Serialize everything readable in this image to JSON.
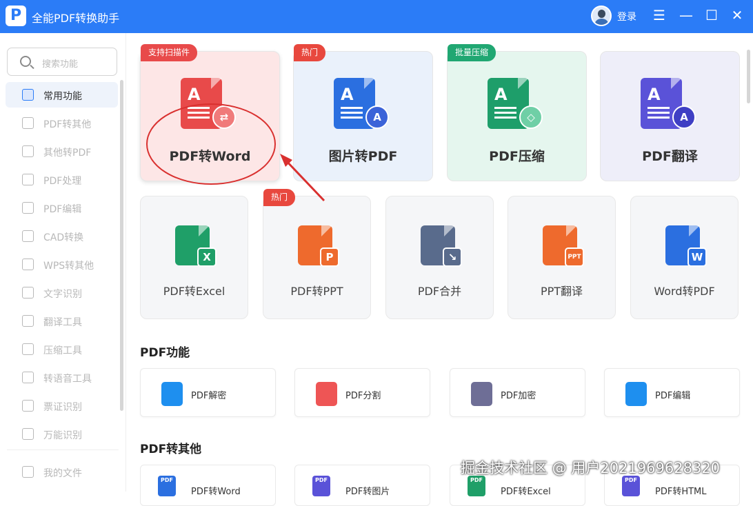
{
  "titlebar": {
    "title": "全能PDF转换助手",
    "logo": "P",
    "login": "登录",
    "menu_icon": "☰",
    "minimize_icon": "—",
    "maximize_icon": "☐",
    "close_icon": "✕"
  },
  "sidebar": {
    "search_placeholder": "搜索功能",
    "items": [
      {
        "label": "常用功能",
        "icon": "grid-icon"
      },
      {
        "label": "PDF转其他",
        "icon": "pdf-export-icon"
      },
      {
        "label": "其他转PDF",
        "icon": "pdf-import-icon"
      },
      {
        "label": "PDF处理",
        "icon": "pdf-process-icon"
      },
      {
        "label": "PDF编辑",
        "icon": "pdf-edit-icon"
      },
      {
        "label": "CAD转换",
        "icon": "cad-icon"
      },
      {
        "label": "WPS转其他",
        "icon": "wps-icon"
      },
      {
        "label": "文字识别",
        "icon": "ocr-icon"
      },
      {
        "label": "翻译工具",
        "icon": "translate-icon"
      },
      {
        "label": "压缩工具",
        "icon": "compress-icon"
      },
      {
        "label": "转语音工具",
        "icon": "speech-icon"
      },
      {
        "label": "票证识别",
        "icon": "ticket-icon"
      },
      {
        "label": "万能识别",
        "icon": "scan-icon"
      }
    ],
    "my_files": "我的文件"
  },
  "featured": [
    {
      "label": "PDF转Word",
      "tag": "支持扫描件",
      "bg": "#fde6e6",
      "tag_color": "#e84a4a",
      "icon_color": "#e84a4a",
      "badge": "⇄",
      "badge_color": "#f07a7a"
    },
    {
      "label": "图片转PDF",
      "tag": "热门",
      "bg": "#eaf1fb",
      "tag_color": "#e8483e",
      "icon_color": "#2b6fe0",
      "badge": "A",
      "badge_color": "#3b63d8"
    },
    {
      "label": "PDF压缩",
      "tag": "批量压缩",
      "bg": "#e5f6ee",
      "tag_color": "#20a772",
      "icon_color": "#1e9e6a",
      "badge": "◇",
      "badge_color": "#6fcfa6"
    },
    {
      "label": "PDF翻译",
      "tag": "",
      "bg": "#eeeef9",
      "tag_color": "#ffffff",
      "icon_color": "#5a52d8",
      "badge": "A",
      "badge_color": "#3f3fc4"
    }
  ],
  "tools": [
    {
      "label": "PDF转Excel",
      "tag": "",
      "icon_color": "#1f9f68",
      "glyph": "X"
    },
    {
      "label": "PDF转PPT",
      "tag": "热门",
      "icon_color": "#ee6a2d",
      "glyph": "P"
    },
    {
      "label": "PDF合并",
      "tag": "",
      "icon_color": "#596b8c",
      "glyph": "↘"
    },
    {
      "label": "PPT翻译",
      "tag": "",
      "icon_color": "#ee6a2d",
      "glyph": "PPT"
    },
    {
      "label": "Word转PDF",
      "tag": "",
      "icon_color": "#2b6fe0",
      "glyph": "W"
    }
  ],
  "pdf_functions": {
    "title": "PDF功能",
    "items": [
      {
        "label": "PDF解密",
        "icon_color": "#1e8fef"
      },
      {
        "label": "PDF分割",
        "icon_color": "#ee5555"
      },
      {
        "label": "PDF加密",
        "icon_color": "#6e6e96"
      },
      {
        "label": "PDF编辑",
        "icon_color": "#1e8fef"
      }
    ]
  },
  "pdf_to_other": {
    "title": "PDF转其他",
    "items": [
      {
        "label": "PDF转Word",
        "icon_color": "#2b6fe0"
      },
      {
        "label": "PDF转图片",
        "icon_color": "#5a52d8"
      },
      {
        "label": "PDF转Excel",
        "icon_color": "#1f9f68"
      },
      {
        "label": "PDF转HTML",
        "icon_color": "#5a52d8"
      }
    ]
  },
  "watermark": "掘金技术社区 @ 用户2021969628320"
}
